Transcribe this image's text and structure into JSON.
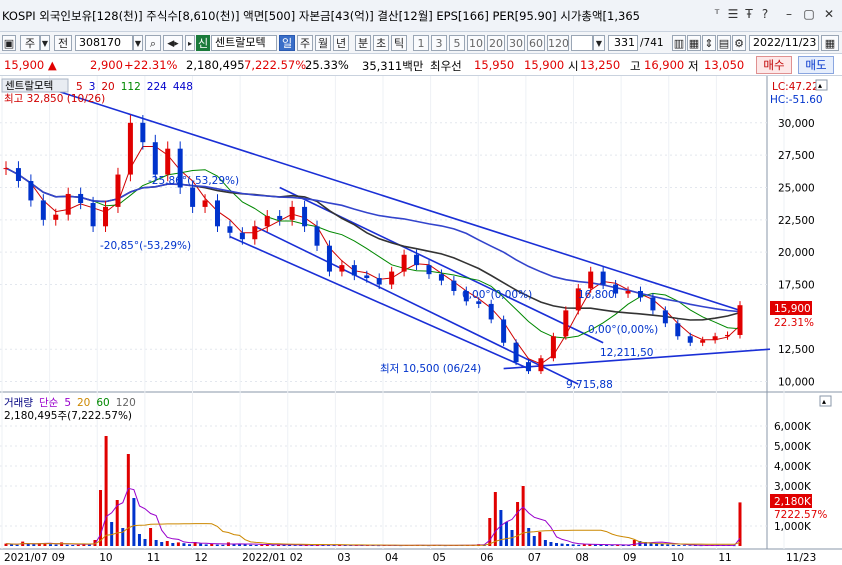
{
  "header": {
    "info_line": "KOSPI 외국인보유[128(천)] 주식수[8,610(천)] 액면[500] 자본금[43(억)] 결산[12월] EPS[166] PER[95.90] 시가총액[1,365"
  },
  "toolbar": {
    "market_select": "주",
    "type_button": "전",
    "code": "308170",
    "badge_new": "신",
    "stock_name": "센트랄모텍",
    "periods": [
      "일",
      "주",
      "월",
      "년",
      "분",
      "초",
      "틱"
    ],
    "intervals": [
      "1",
      "3",
      "5",
      "10",
      "20",
      "30",
      "60",
      "120"
    ],
    "page_counter": "331",
    "page_total": "/741",
    "date": "2022/11/23"
  },
  "price_bar": {
    "price": "15,900 ▲",
    "change": "2,900",
    "change_pct": "+22.31%",
    "volume": "2,180,495",
    "volume_pct": "7,222.57%",
    "turnover": "25.33%",
    "trade_value": "35,311백만",
    "best_ask_label": "최우선",
    "best_ask": "15,950",
    "best_bid": "15,900",
    "open_label": "시",
    "open": "13,250",
    "high_label": "고",
    "high": "16,900",
    "low_label": "저",
    "low": "13,050",
    "buy_label": "매수",
    "sell_label": "매도"
  },
  "chart_data": {
    "type": "line",
    "title": "센트랄모텍",
    "price_axis": [
      "30,000",
      "27,500",
      "25,000",
      "22,500",
      "20,000",
      "17,500",
      "12,500",
      "10,000"
    ],
    "price_min": 9500,
    "price_max": 33000,
    "current_price_tag": "15,900",
    "change_tag": "22.31%",
    "lc_label": "LC:47.22",
    "hc_label": "HC:-51.60",
    "ma_legend": [
      "5",
      "3",
      "20",
      "112",
      "224",
      "448"
    ],
    "ma_colors": [
      "#d00000",
      "#0000cc",
      "#d00000",
      "#008800",
      "#0000cc",
      "#0000cc"
    ],
    "high_annotation": "최고 32,850 (10/26)",
    "low_annotation": "최저 10,500 (06/24)",
    "annotations": [
      "-25,86°(-53,29%)",
      "-20,85°(-53,29%)",
      "0,00°(0,00%)",
      "16,800",
      "0,00°(0,00%)",
      "12,211,50",
      "9,715,88"
    ],
    "x_labels": [
      "2021/07",
      "09",
      "10",
      "11",
      "12",
      "2022/01",
      "02",
      "03",
      "04",
      "05",
      "06",
      "07",
      "08",
      "09",
      "10",
      "11",
      "11/23"
    ],
    "price_series": [
      [
        "2021/07",
        26500
      ],
      [
        "07",
        25500
      ],
      [
        "08",
        24000
      ],
      [
        "08",
        22500
      ],
      [
        "08",
        22900
      ],
      [
        "08",
        24500
      ],
      [
        "09",
        23800
      ],
      [
        "09",
        22000
      ],
      [
        "09",
        23500
      ],
      [
        "10",
        26000
      ],
      [
        "10",
        30000
      ],
      [
        "10",
        28500
      ],
      [
        "10",
        26000
      ],
      [
        "10",
        28000
      ],
      [
        "11",
        25000
      ],
      [
        "11",
        23500
      ],
      [
        "11",
        24000
      ],
      [
        "11",
        22000
      ],
      [
        "12",
        21500
      ],
      [
        "12",
        21000
      ],
      [
        "12",
        22000
      ],
      [
        "12",
        22800
      ],
      [
        "01",
        22500
      ],
      [
        "01",
        23500
      ],
      [
        "01",
        22000
      ],
      [
        "01",
        20500
      ],
      [
        "02",
        18500
      ],
      [
        "02",
        19000
      ],
      [
        "02",
        18200
      ],
      [
        "03",
        18000
      ],
      [
        "03",
        17500
      ],
      [
        "03",
        18500
      ],
      [
        "04",
        19800
      ],
      [
        "04",
        19000
      ],
      [
        "04",
        18300
      ],
      [
        "05",
        17800
      ],
      [
        "05",
        17000
      ],
      [
        "05",
        16200
      ],
      [
        "06",
        16000
      ],
      [
        "06",
        14800
      ],
      [
        "06",
        13000
      ],
      [
        "06",
        11500
      ],
      [
        "07",
        10800
      ],
      [
        "07",
        11800
      ],
      [
        "07",
        13500
      ],
      [
        "07",
        15500
      ],
      [
        "08",
        17200
      ],
      [
        "08",
        18500
      ],
      [
        "08",
        17500
      ],
      [
        "08",
        16800
      ],
      [
        "09",
        17000
      ],
      [
        "09",
        16500
      ],
      [
        "09",
        15500
      ],
      [
        "10",
        14500
      ],
      [
        "10",
        13500
      ],
      [
        "10",
        13000
      ],
      [
        "11",
        13200
      ],
      [
        "11",
        13500
      ],
      [
        "11",
        13600
      ],
      [
        "11/23",
        15900
      ]
    ],
    "volume_legend": [
      "거래량",
      "단순",
      "5",
      "20",
      "60",
      "120"
    ],
    "volume_legend_colors": [
      "#000080",
      "#9900cc",
      "#9900cc",
      "#cc8800",
      "#008800",
      "#666666"
    ],
    "volume_summary": "2,180,495주(7,222.57%)",
    "volume_axis": [
      "6,000K",
      "5,000K",
      "4,000K",
      "3,000K",
      "1,000K"
    ],
    "volume_max_k": 6800,
    "volume_tag": "2,180K",
    "volume_tag_pct": "7222.57%",
    "volume_series_k": [
      120,
      80,
      60,
      220,
      110,
      90,
      140,
      150,
      90,
      70,
      180,
      60,
      50,
      60,
      80,
      70,
      300,
      2800,
      5500,
      1200,
      2300,
      900,
      4600,
      2400,
      600,
      350,
      900,
      300,
      200,
      250,
      150,
      180,
      140,
      90,
      200,
      120,
      80,
      100,
      70,
      60,
      180,
      120,
      90,
      80,
      60,
      50,
      70,
      90,
      40,
      80,
      60,
      50,
      40,
      30,
      60,
      50,
      80,
      70,
      40,
      30,
      50,
      40,
      30,
      60,
      30,
      40,
      30,
      20,
      30,
      40,
      30,
      20,
      30,
      40,
      50,
      30,
      20,
      40,
      30,
      20,
      30,
      50,
      30,
      40,
      60,
      90,
      80,
      1400,
      2700,
      1800,
      1200,
      800,
      2200,
      3000,
      900,
      500,
      700,
      300,
      200,
      150,
      120,
      100,
      80,
      60,
      80,
      90,
      70,
      60,
      50,
      40,
      60,
      50,
      40,
      300,
      250,
      200,
      180,
      150,
      100,
      80,
      60,
      50,
      40,
      30,
      25,
      20,
      30,
      40,
      35,
      30,
      25,
      20,
      2180
    ]
  }
}
